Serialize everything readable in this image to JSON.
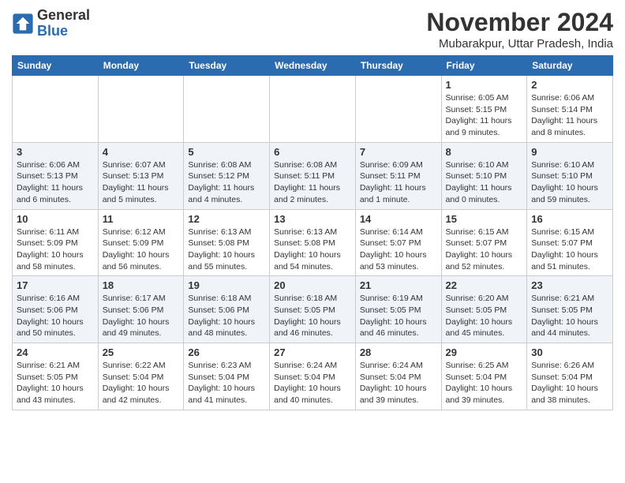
{
  "header": {
    "logo_line1": "General",
    "logo_line2": "Blue",
    "month": "November 2024",
    "location": "Mubarakpur, Uttar Pradesh, India"
  },
  "weekdays": [
    "Sunday",
    "Monday",
    "Tuesday",
    "Wednesday",
    "Thursday",
    "Friday",
    "Saturday"
  ],
  "weeks": [
    [
      {
        "day": "",
        "info": ""
      },
      {
        "day": "",
        "info": ""
      },
      {
        "day": "",
        "info": ""
      },
      {
        "day": "",
        "info": ""
      },
      {
        "day": "",
        "info": ""
      },
      {
        "day": "1",
        "info": "Sunrise: 6:05 AM\nSunset: 5:15 PM\nDaylight: 11 hours and 9 minutes."
      },
      {
        "day": "2",
        "info": "Sunrise: 6:06 AM\nSunset: 5:14 PM\nDaylight: 11 hours and 8 minutes."
      }
    ],
    [
      {
        "day": "3",
        "info": "Sunrise: 6:06 AM\nSunset: 5:13 PM\nDaylight: 11 hours and 6 minutes."
      },
      {
        "day": "4",
        "info": "Sunrise: 6:07 AM\nSunset: 5:13 PM\nDaylight: 11 hours and 5 minutes."
      },
      {
        "day": "5",
        "info": "Sunrise: 6:08 AM\nSunset: 5:12 PM\nDaylight: 11 hours and 4 minutes."
      },
      {
        "day": "6",
        "info": "Sunrise: 6:08 AM\nSunset: 5:11 PM\nDaylight: 11 hours and 2 minutes."
      },
      {
        "day": "7",
        "info": "Sunrise: 6:09 AM\nSunset: 5:11 PM\nDaylight: 11 hours and 1 minute."
      },
      {
        "day": "8",
        "info": "Sunrise: 6:10 AM\nSunset: 5:10 PM\nDaylight: 11 hours and 0 minutes."
      },
      {
        "day": "9",
        "info": "Sunrise: 6:10 AM\nSunset: 5:10 PM\nDaylight: 10 hours and 59 minutes."
      }
    ],
    [
      {
        "day": "10",
        "info": "Sunrise: 6:11 AM\nSunset: 5:09 PM\nDaylight: 10 hours and 58 minutes."
      },
      {
        "day": "11",
        "info": "Sunrise: 6:12 AM\nSunset: 5:09 PM\nDaylight: 10 hours and 56 minutes."
      },
      {
        "day": "12",
        "info": "Sunrise: 6:13 AM\nSunset: 5:08 PM\nDaylight: 10 hours and 55 minutes."
      },
      {
        "day": "13",
        "info": "Sunrise: 6:13 AM\nSunset: 5:08 PM\nDaylight: 10 hours and 54 minutes."
      },
      {
        "day": "14",
        "info": "Sunrise: 6:14 AM\nSunset: 5:07 PM\nDaylight: 10 hours and 53 minutes."
      },
      {
        "day": "15",
        "info": "Sunrise: 6:15 AM\nSunset: 5:07 PM\nDaylight: 10 hours and 52 minutes."
      },
      {
        "day": "16",
        "info": "Sunrise: 6:15 AM\nSunset: 5:07 PM\nDaylight: 10 hours and 51 minutes."
      }
    ],
    [
      {
        "day": "17",
        "info": "Sunrise: 6:16 AM\nSunset: 5:06 PM\nDaylight: 10 hours and 50 minutes."
      },
      {
        "day": "18",
        "info": "Sunrise: 6:17 AM\nSunset: 5:06 PM\nDaylight: 10 hours and 49 minutes."
      },
      {
        "day": "19",
        "info": "Sunrise: 6:18 AM\nSunset: 5:06 PM\nDaylight: 10 hours and 48 minutes."
      },
      {
        "day": "20",
        "info": "Sunrise: 6:18 AM\nSunset: 5:05 PM\nDaylight: 10 hours and 46 minutes."
      },
      {
        "day": "21",
        "info": "Sunrise: 6:19 AM\nSunset: 5:05 PM\nDaylight: 10 hours and 46 minutes."
      },
      {
        "day": "22",
        "info": "Sunrise: 6:20 AM\nSunset: 5:05 PM\nDaylight: 10 hours and 45 minutes."
      },
      {
        "day": "23",
        "info": "Sunrise: 6:21 AM\nSunset: 5:05 PM\nDaylight: 10 hours and 44 minutes."
      }
    ],
    [
      {
        "day": "24",
        "info": "Sunrise: 6:21 AM\nSunset: 5:05 PM\nDaylight: 10 hours and 43 minutes."
      },
      {
        "day": "25",
        "info": "Sunrise: 6:22 AM\nSunset: 5:04 PM\nDaylight: 10 hours and 42 minutes."
      },
      {
        "day": "26",
        "info": "Sunrise: 6:23 AM\nSunset: 5:04 PM\nDaylight: 10 hours and 41 minutes."
      },
      {
        "day": "27",
        "info": "Sunrise: 6:24 AM\nSunset: 5:04 PM\nDaylight: 10 hours and 40 minutes."
      },
      {
        "day": "28",
        "info": "Sunrise: 6:24 AM\nSunset: 5:04 PM\nDaylight: 10 hours and 39 minutes."
      },
      {
        "day": "29",
        "info": "Sunrise: 6:25 AM\nSunset: 5:04 PM\nDaylight: 10 hours and 39 minutes."
      },
      {
        "day": "30",
        "info": "Sunrise: 6:26 AM\nSunset: 5:04 PM\nDaylight: 10 hours and 38 minutes."
      }
    ]
  ]
}
